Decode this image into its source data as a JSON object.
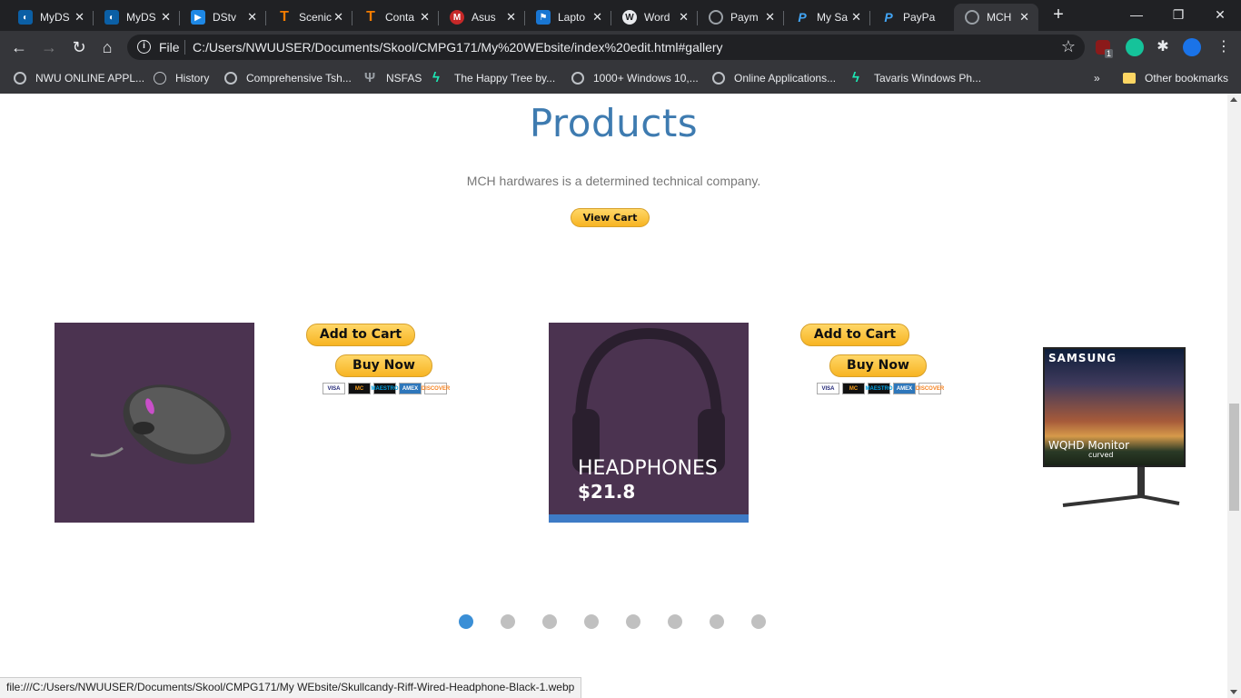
{
  "browser": {
    "tabs": [
      {
        "title": "MyDS",
        "icon": "mydsl-icon",
        "color": "#0b5fa5"
      },
      {
        "title": "MyDS",
        "icon": "mydsl-icon",
        "color": "#0b5fa5"
      },
      {
        "title": "DStv",
        "icon": "dstv-play-icon",
        "color": "#1e88e5"
      },
      {
        "title": "Scenic",
        "icon": "letter-t-icon",
        "color": "#f57c00"
      },
      {
        "title": "Conta",
        "icon": "letter-t-icon",
        "color": "#f57c00"
      },
      {
        "title": "Asus",
        "icon": "mcafee-icon",
        "color": "#c62828"
      },
      {
        "title": "Lapto",
        "icon": "flag-icon",
        "color": "#1976d2"
      },
      {
        "title": "Word",
        "icon": "wordpress-icon",
        "color": "#5f6368"
      },
      {
        "title": "Paym",
        "icon": "globe-icon",
        "color": "#5f6368"
      },
      {
        "title": "My Sa",
        "icon": "paypal-icon",
        "color": "#1565c0"
      },
      {
        "title": "PayPa",
        "icon": "paypal-icon",
        "color": "#1565c0"
      },
      {
        "title": "MCH",
        "icon": "globe-icon",
        "color": "#5f6368",
        "active": true
      }
    ],
    "toolbar": {
      "file_label": "File",
      "url": "C:/Users/NWUUSER/Documents/Skool/CMPG171/My%20WEbsite/index%20edit.html#gallery"
    },
    "extension_badge": "1",
    "bookmarks": [
      {
        "label": "NWU ONLINE APPL...",
        "icon": "globe-icon"
      },
      {
        "label": "History",
        "icon": "history-icon"
      },
      {
        "label": "Comprehensive Tsh...",
        "icon": "globe-icon"
      },
      {
        "label": "NSFAS",
        "icon": "nsfas-icon"
      },
      {
        "label": "The Happy Tree by...",
        "icon": "happytree-icon"
      },
      {
        "label": "1000+ Windows 10,...",
        "icon": "globe-icon"
      },
      {
        "label": "Online Applications...",
        "icon": "globe-icon"
      },
      {
        "label": "Tavaris Windows Ph...",
        "icon": "happytree-icon"
      }
    ],
    "other_bookmarks": "Other bookmarks",
    "more_bookmarks": "»"
  },
  "page": {
    "heading": "Products",
    "tagline": "MCH hardwares is a determined technical company.",
    "view_cart": "View Cart",
    "add_to_cart": "Add to Cart",
    "buy_now": "Buy Now",
    "card_logos": [
      "VISA",
      "MC",
      "MAESTRO",
      "AMEX",
      "DISCOVER"
    ],
    "products": [
      {
        "name": "",
        "price": "",
        "image": "gaming-mouse"
      },
      {
        "name": "HEADPHONES",
        "price": "$21.8",
        "image": "headphones"
      },
      {
        "name": "",
        "price": "",
        "image": "samsung-monitor",
        "brand": "SAMSUNG",
        "label": "WQHD Monitor",
        "sublabel": "curved"
      }
    ],
    "carousel_dots": 8,
    "active_dot": 0
  },
  "status_bar": "file:///C:/Users/NWUUSER/Documents/Skool/CMPG171/My WEbsite/Skullcandy-Riff-Wired-Headphone-Black-1.webp",
  "colors": {
    "heading": "#3e7bb0",
    "accent_blue": "#3b8fd6",
    "paypal_gold": "#f7b422",
    "product_bg": "#4b3350"
  }
}
